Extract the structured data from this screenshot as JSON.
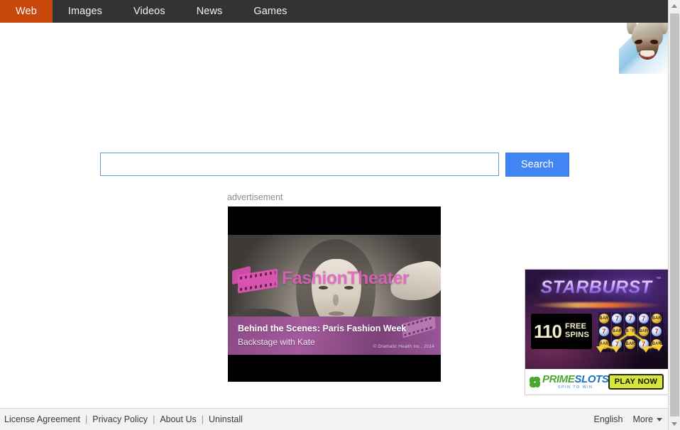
{
  "nav": {
    "items": [
      {
        "label": "Web",
        "active": true
      },
      {
        "label": "Images",
        "active": false
      },
      {
        "label": "Videos",
        "active": false
      },
      {
        "label": "News",
        "active": false
      },
      {
        "label": "Games",
        "active": false
      }
    ]
  },
  "corner_ad": {
    "name": "game-character-popup-ad",
    "close_glyph": "×",
    "art_description": "helmeted warrior character"
  },
  "search": {
    "value": "",
    "placeholder": "",
    "button_label": "Search"
  },
  "video_ad": {
    "label": "advertisement",
    "brand": "FashionTheater",
    "title": "Behind the Scenes: Paris Fashion Week",
    "subtitle": "Backstage with Kate",
    "copyright": "© Dramatic Health Inc., 2014"
  },
  "slot_ad": {
    "title": "STARBURST",
    "trademark": "™",
    "offer_number": "110",
    "offer_word1": "FREE",
    "offer_word2": "SPINS",
    "brand_part1": "PRIME",
    "brand_part2": "SLOTS",
    "brand_tagline": "SPIN TO WIN",
    "cta_label": "PLAY NOW",
    "reels": [
      [
        "BAR",
        "7",
        "BAR"
      ],
      [
        "7",
        "BAR",
        "7"
      ],
      [
        "7",
        "BAR",
        "BAR"
      ],
      [
        "7",
        "BAR",
        "7"
      ],
      [
        "BAR",
        "7",
        "BAR"
      ]
    ]
  },
  "footer": {
    "links": [
      "License Agreement",
      "Privacy Policy",
      "About Us",
      "Uninstall"
    ],
    "separator": "|",
    "language": "English",
    "more_label": "More"
  },
  "colors": {
    "nav_background": "#333333",
    "nav_active": "#c8470a",
    "search_button": "#4285f4",
    "footer_background": "#f2f2f2",
    "brand_magenta": "#e25fc0",
    "caption_purple": "#8d4a86",
    "play_now_yellow": "#d7e63a"
  }
}
